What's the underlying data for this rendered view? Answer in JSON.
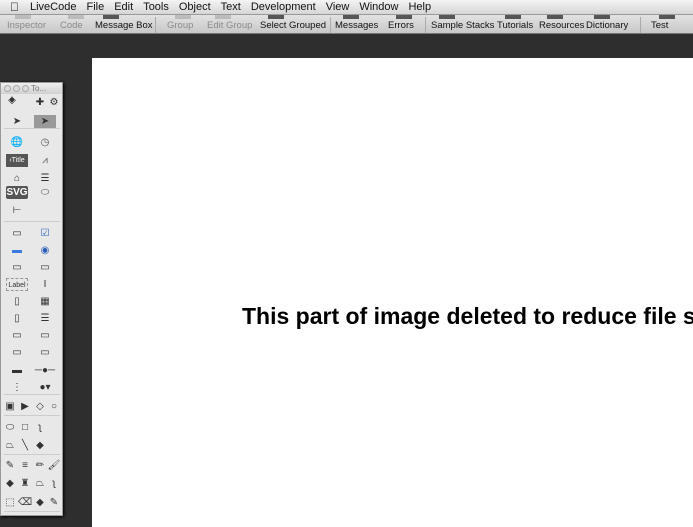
{
  "menubar": {
    "items": [
      "LiveCode",
      "File",
      "Edit",
      "Tools",
      "Object",
      "Text",
      "Development",
      "View",
      "Window",
      "Help"
    ]
  },
  "toolbar": {
    "items": [
      {
        "label": "Inspector",
        "disabled": true
      },
      {
        "label": "Code",
        "disabled": true
      },
      {
        "label": "Message Box",
        "disabled": false
      },
      {
        "label": "Group",
        "disabled": true
      },
      {
        "label": "Edit Group",
        "disabled": true
      },
      {
        "label": "Select Grouped",
        "disabled": false
      },
      {
        "label": "Messages",
        "disabled": false
      },
      {
        "label": "Errors",
        "disabled": false
      },
      {
        "label": "Sample Stacks",
        "disabled": false
      },
      {
        "label": "Tutorials",
        "disabled": false
      },
      {
        "label": "Resources",
        "disabled": false
      },
      {
        "label": "Dictionary",
        "disabled": false
      },
      {
        "label": "Test",
        "disabled": false
      }
    ]
  },
  "canvas": {
    "message": "This part of image deleted to reduce file size"
  },
  "palette": {
    "title": "To...",
    "tools": [
      {
        "name": "add-icon",
        "g": "✚"
      },
      {
        "name": "gear-icon",
        "g": "⚙"
      },
      {
        "name": "pointer-tool-icon",
        "g": "➤"
      },
      {
        "name": "run-edit-tool-icon",
        "g": "➤"
      },
      {
        "name": "browser-widget-icon",
        "g": "🌐"
      },
      {
        "name": "clock-widget-icon",
        "g": "◷"
      },
      {
        "name": "header-bar-widget-icon",
        "g": "‹Title"
      },
      {
        "name": "line-graph-widget-icon",
        "g": "⩘"
      },
      {
        "name": "navigation-bar-icon",
        "g": "⌂"
      },
      {
        "name": "segmented-control-icon",
        "g": "☰"
      },
      {
        "name": "svg-icon-widget-icon",
        "g": "SVG"
      },
      {
        "name": "switch-button-icon",
        "g": "⬭"
      },
      {
        "name": "tree-view-icon",
        "g": "⊢"
      },
      {
        "name": "push-button-icon",
        "g": "▭"
      },
      {
        "name": "checkbox-icon",
        "g": "☑"
      },
      {
        "name": "default-button-icon",
        "g": "▬"
      },
      {
        "name": "radio-button-icon",
        "g": "◉"
      },
      {
        "name": "rectangle-button-icon",
        "g": "▭"
      },
      {
        "name": "tab-panel-icon",
        "g": "▭"
      },
      {
        "name": "label-field-icon",
        "g": "Label"
      },
      {
        "name": "text-field-icon",
        "g": "I"
      },
      {
        "name": "scrolling-field-icon",
        "g": "▯"
      },
      {
        "name": "table-field-icon",
        "g": "▦"
      },
      {
        "name": "list-field-icon",
        "g": "▯"
      },
      {
        "name": "scrolling-list-icon",
        "g": "☰"
      },
      {
        "name": "option-menu-icon",
        "g": "▭"
      },
      {
        "name": "popup-menu-icon",
        "g": "▭"
      },
      {
        "name": "combo-box-icon",
        "g": "▭"
      },
      {
        "name": "pulldown-menu-icon",
        "g": "▭"
      },
      {
        "name": "progress-bar-icon",
        "g": "▬"
      },
      {
        "name": "slider-icon",
        "g": "─●─"
      },
      {
        "name": "scrollbar-icon",
        "g": "⋮"
      },
      {
        "name": "little-arrows-icon",
        "g": "●▾"
      },
      {
        "name": "image-icon",
        "g": "▣"
      },
      {
        "name": "player-icon",
        "g": "▶"
      },
      {
        "name": "diamond-icon",
        "g": "◇"
      },
      {
        "name": "circle-icon",
        "g": "○"
      },
      {
        "name": "oval-icon",
        "g": "⬭"
      },
      {
        "name": "rectangle-icon",
        "g": "□"
      },
      {
        "name": "freehand-icon",
        "g": "ʅ"
      },
      {
        "name": "polygon-icon",
        "g": "⏢"
      },
      {
        "name": "line-icon",
        "g": "╲"
      },
      {
        "name": "fill-color-icon",
        "g": "◆"
      },
      {
        "name": "line-color-icon",
        "g": "✎"
      },
      {
        "name": "line-width-icon",
        "g": "≡"
      },
      {
        "name": "pencil-icon",
        "g": "✏"
      },
      {
        "name": "brush-icon",
        "g": "🖌"
      },
      {
        "name": "bucket-icon",
        "g": "◆"
      },
      {
        "name": "spray-icon",
        "g": "♜"
      },
      {
        "name": "paint-polygon-icon",
        "g": "⏢"
      },
      {
        "name": "paint-freehand-icon",
        "g": "ʅ"
      },
      {
        "name": "select-icon",
        "g": "⬚"
      },
      {
        "name": "eraser-icon",
        "g": "⌫"
      },
      {
        "name": "paint-fill-color-icon",
        "g": "◆"
      },
      {
        "name": "paint-line-color-icon",
        "g": "✎"
      },
      {
        "name": "paint-width-icon",
        "g": "≡"
      },
      {
        "name": "brush-shape-icon",
        "g": "◈"
      },
      {
        "name": "paint-pattern-icon",
        "g": "✦"
      }
    ]
  }
}
